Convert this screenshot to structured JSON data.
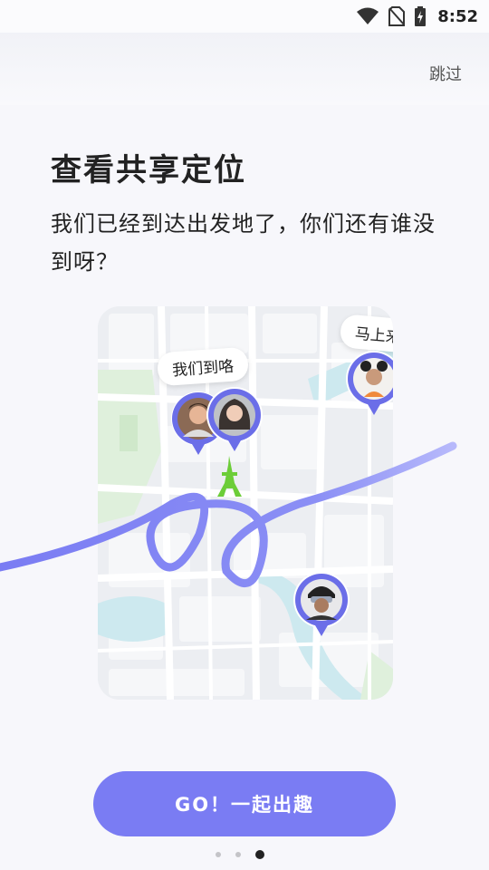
{
  "status_bar": {
    "time": "8:52",
    "icons": [
      "wifi-icon",
      "no-sim-icon",
      "battery-charging-icon"
    ]
  },
  "header": {
    "skip_label": "跳过"
  },
  "content": {
    "title": "查看共享定位",
    "subtitle": "我们已经到达出发地了，你们还有谁没到呀？"
  },
  "map": {
    "bubble_arrived": "我们到咯",
    "bubble_coming": "马上来!",
    "landmark_icon": "tower-icon",
    "landmark_color": "#6ccd38",
    "route_color": "#7a7cf3"
  },
  "cta": {
    "label": "GO！一起出趣"
  },
  "pager": {
    "count": 3,
    "active_index": 2
  },
  "colors": {
    "accent": "#7a7cf3",
    "background": "#f7f7fb"
  }
}
